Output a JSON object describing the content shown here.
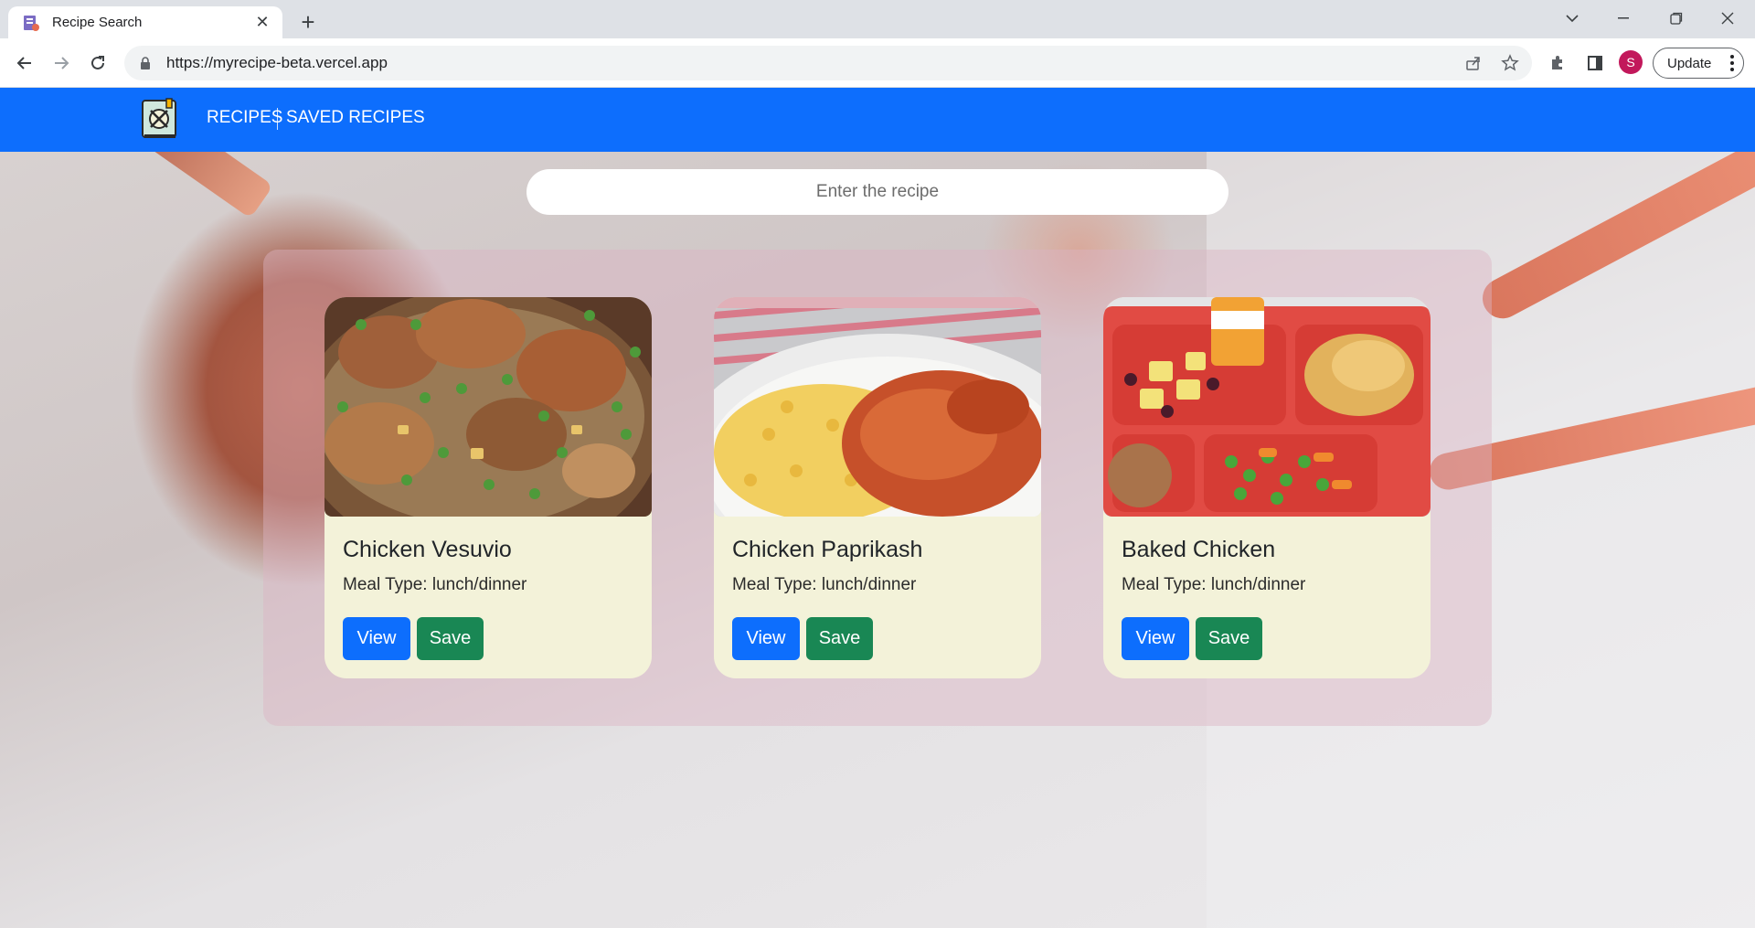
{
  "browser": {
    "tab_title": "Recipe Search",
    "url": "https://myrecipe-beta.vercel.app",
    "profile_initial": "S",
    "update_label": "Update"
  },
  "navbar": {
    "links": [
      "RECIPES",
      "SAVED RECIPES"
    ]
  },
  "search": {
    "placeholder": "Enter the recipe"
  },
  "recipes": [
    {
      "title": "Chicken Vesuvio",
      "meal": "Meal Type: lunch/dinner",
      "view": "View",
      "save": "Save"
    },
    {
      "title": "Chicken Paprikash",
      "meal": "Meal Type: lunch/dinner",
      "view": "View",
      "save": "Save"
    },
    {
      "title": "Baked Chicken",
      "meal": "Meal Type: lunch/dinner",
      "view": "View",
      "save": "Save"
    }
  ],
  "colors": {
    "navbar": "#0d6efd",
    "view_button": "#0d6efd",
    "save_button": "#198754",
    "card": "#f3f2d9"
  }
}
